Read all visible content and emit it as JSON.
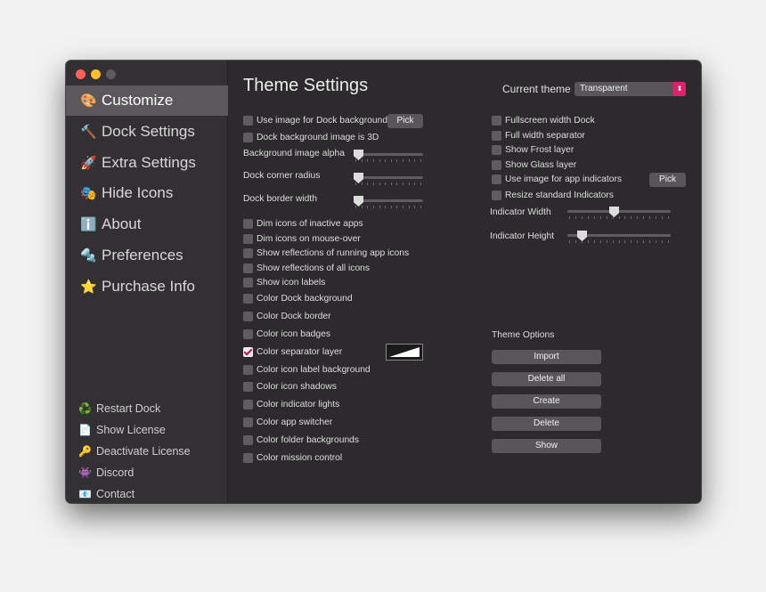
{
  "sidebar": {
    "items": [
      {
        "icon": "🎨",
        "label": "Customize"
      },
      {
        "icon": "🔨",
        "label": "Dock Settings"
      },
      {
        "icon": "🚀",
        "label": "Extra Settings"
      },
      {
        "icon": "🎭",
        "label": "Hide Icons"
      },
      {
        "icon": "ℹ️",
        "label": "About"
      },
      {
        "icon": "🔩",
        "label": "Preferences"
      },
      {
        "icon": "⭐",
        "label": "Purchase Info"
      }
    ],
    "footer": [
      {
        "icon": "♻️",
        "label": "Restart Dock"
      },
      {
        "icon": "📄",
        "label": "Show License"
      },
      {
        "icon": "🔑",
        "label": "Deactivate License"
      },
      {
        "icon": "👾",
        "label": "Discord"
      },
      {
        "icon": "📧",
        "label": "Contact"
      }
    ]
  },
  "main": {
    "title": "Theme Settings",
    "current_theme_label": "Current theme",
    "current_theme_value": "Transparent",
    "pick_label": "Pick",
    "left_top": [
      {
        "label": "Use image for Dock background",
        "checked": false
      },
      {
        "label": "Dock background image is 3D",
        "checked": false
      }
    ],
    "left_sliders": [
      {
        "label": "Background image alpha",
        "value": 0.0
      },
      {
        "label": "Dock corner radius",
        "value": 0.0
      },
      {
        "label": "Dock border width",
        "value": 0.0
      }
    ],
    "left_options": [
      {
        "label": "Dim icons of inactive apps",
        "checked": false
      },
      {
        "label": "Dim icons on mouse-over",
        "checked": false
      },
      {
        "label": "Show reflections of running app icons",
        "checked": false
      },
      {
        "label": "Show reflections of all icons",
        "checked": false
      },
      {
        "label": "Show icon labels",
        "checked": false
      },
      {
        "label": "Color Dock background",
        "checked": false
      },
      {
        "label": "Color Dock border",
        "checked": false
      },
      {
        "label": "Color icon badges",
        "checked": false
      },
      {
        "label": "Color separator layer",
        "checked": true
      },
      {
        "label": "Color icon label background",
        "checked": false
      },
      {
        "label": "Color icon shadows",
        "checked": false
      },
      {
        "label": "Color indicator lights",
        "checked": false
      },
      {
        "label": "Color app switcher",
        "checked": false
      },
      {
        "label": "Color folder backgrounds",
        "checked": false
      },
      {
        "label": "Color mission control",
        "checked": false
      }
    ],
    "right_options": [
      {
        "label": "Fullscreen width Dock",
        "checked": false
      },
      {
        "label": "Full width separator",
        "checked": false
      },
      {
        "label": "Show Frost layer",
        "checked": false
      },
      {
        "label": "Show Glass layer",
        "checked": false
      },
      {
        "label": "Use image for app indicators",
        "checked": false
      },
      {
        "label": "Resize standard Indicators",
        "checked": false
      }
    ],
    "right_sliders": [
      {
        "label": "Indicator Width",
        "value": 0.45
      },
      {
        "label": "Indicator Height",
        "value": 0.1
      }
    ],
    "theme_options": {
      "title": "Theme Options",
      "buttons": [
        "Import",
        "Delete all",
        "Create",
        "Delete",
        "Show"
      ]
    }
  },
  "colors": {
    "accent": "#e0206a",
    "check_mark": "#d10c4c",
    "window_bg": "#2c2a2c",
    "sidebar_bg": "#333033",
    "sidebar_active": "#5a585a"
  }
}
